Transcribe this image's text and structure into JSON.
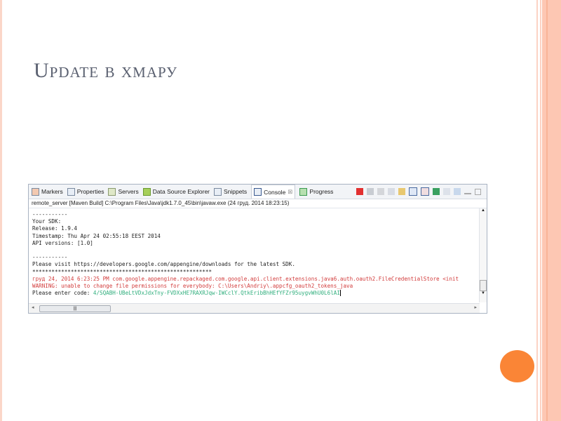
{
  "slide": {
    "title": "Update в хмару"
  },
  "tabs": [
    {
      "label": "Markers"
    },
    {
      "label": "Properties"
    },
    {
      "label": "Servers"
    },
    {
      "label": "Data Source Explorer"
    },
    {
      "label": "Snippets"
    },
    {
      "label": "Console",
      "close": "⊠"
    },
    {
      "label": "Progress"
    }
  ],
  "description": "remote_server [Maven Build] C:\\Program Files\\Java\\jdk1.7.0_45\\bin\\javaw.exe (24 груд. 2014 18:23:15)",
  "console": {
    "lines": [
      "-----------",
      "Your SDK:",
      "Release: 1.9.4",
      "Timestamp: Thu Apr 24 02:55:18 EEST 2014",
      "API versions: [1.0]",
      "",
      "-----------",
      "Please visit https://developers.google.com/appengine/downloads for the latest SDK.",
      "********************************************************"
    ],
    "err1": "груд 24, 2014 6:23:25 PM com.google.appengine.repackaged.com.google.api.client.extensions.java6.auth.oauth2.FileCredentialStore <init",
    "err2": "WARNING: unable to change file permissions for everybody: C:\\Users\\Andriy\\.appcfg_oauth2_tokens_java",
    "prompt": "Please enter code: ",
    "code": "4/SQABH-UBeLtVDxJdxTny-FVDXxHE7RAXRJqw-IWCclY.QtkEribBhHEfYFZr95uygvWhU0L6lAI"
  },
  "colors": {
    "accent": "#fa8536",
    "error": "#d23b3b",
    "input": "#2fae7c"
  }
}
